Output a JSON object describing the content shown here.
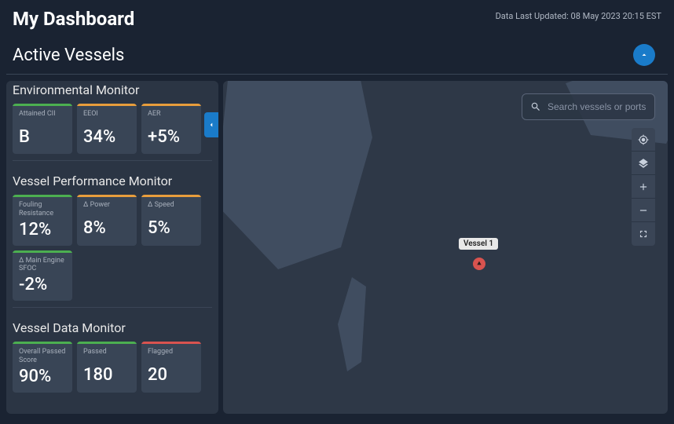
{
  "header": {
    "title": "My Dashboard",
    "updated_prefix": "Data Last Updated: ",
    "updated_value": "08 May 2023 20:15 EST"
  },
  "subheader": {
    "title": "Active Vessels"
  },
  "search": {
    "placeholder": "Search vessels or ports"
  },
  "sections": {
    "env": {
      "title": "Environmental Monitor",
      "tiles": [
        {
          "label": "Attained CII",
          "value": "B",
          "bar": "green"
        },
        {
          "label": "EEOI",
          "value": "34%",
          "bar": "orange"
        },
        {
          "label": "AER",
          "value": "+5%",
          "bar": "orange"
        }
      ]
    },
    "perf": {
      "title": "Vessel Performance Monitor",
      "tiles": [
        {
          "label": "Fouling Resistance",
          "value": "12%",
          "bar": "green"
        },
        {
          "label": "Δ Power",
          "value": "8%",
          "bar": "orange"
        },
        {
          "label": "Δ  Speed",
          "value": "5%",
          "bar": "orange"
        },
        {
          "label": "Δ Main Engine SFOC",
          "value": "-2%",
          "bar": "green"
        }
      ]
    },
    "data": {
      "title": "Vessel Data Monitor",
      "tiles": [
        {
          "label": "Overall Passed Score",
          "value": "90%",
          "bar": "green"
        },
        {
          "label": "Passed",
          "value": "180",
          "bar": "green"
        },
        {
          "label": "Flagged",
          "value": "20",
          "bar": "red"
        }
      ]
    }
  },
  "map": {
    "vessel_label": "Vessel 1"
  },
  "colors": {
    "bg": "#1a2332",
    "panel": "#2b3544",
    "tile": "#394556",
    "accent": "#1a7bc9",
    "green": "#4caf50",
    "orange": "#e89d3c",
    "red": "#d9534f"
  }
}
